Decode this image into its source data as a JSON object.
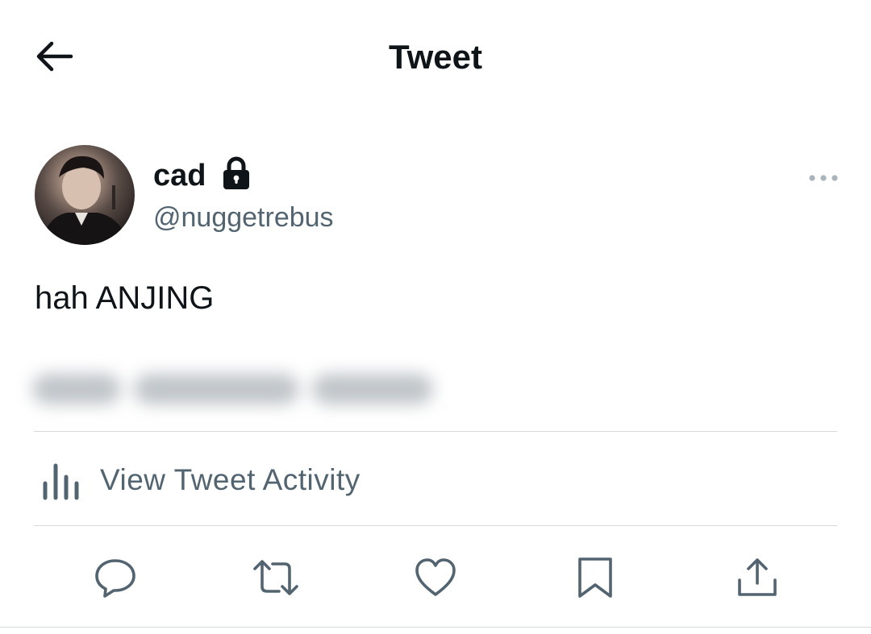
{
  "header": {
    "title": "Tweet",
    "back_icon": "arrow-left-icon"
  },
  "author": {
    "display_name": "cad",
    "handle": "@nuggetrebus",
    "protected_icon": "lock-icon",
    "more_icon": "ellipsis-icon"
  },
  "tweet": {
    "text": "hah ANJING"
  },
  "activity": {
    "label": "View Tweet Activity",
    "icon": "bar-chart-icon"
  },
  "actions": [
    {
      "name": "reply",
      "icon": "reply-icon"
    },
    {
      "name": "retweet",
      "icon": "retweet-icon"
    },
    {
      "name": "like",
      "icon": "heart-icon"
    },
    {
      "name": "bookmark",
      "icon": "bookmark-icon"
    },
    {
      "name": "share",
      "icon": "share-icon"
    }
  ],
  "colors": {
    "text_primary": "#0f1419",
    "text_secondary": "#536471",
    "divider": "#d4d9dd",
    "background": "#ffffff"
  }
}
